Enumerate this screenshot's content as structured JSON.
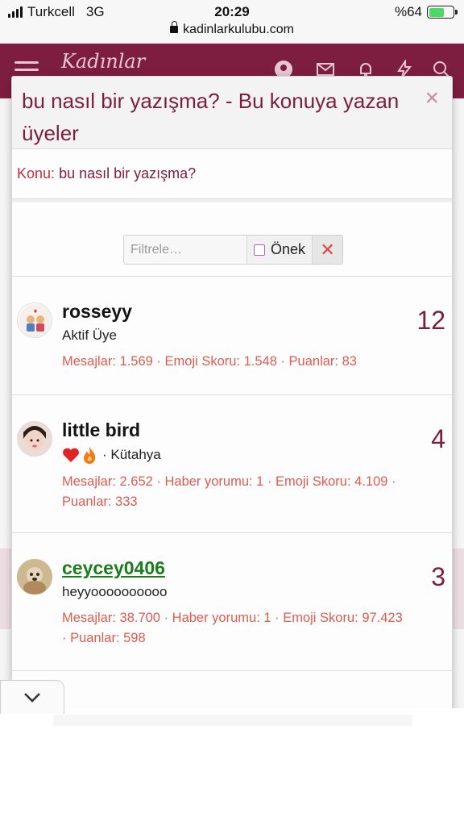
{
  "status_bar": {
    "carrier": "Turkcell",
    "network": "3G",
    "time": "20:29",
    "battery": "%64"
  },
  "browser": {
    "url": "kadinlarkulubu.com"
  },
  "site": {
    "logo": "Kadınlar"
  },
  "modal": {
    "title": "bu nasıl bir yazışma? - Bu konuya yazan üyeler",
    "close": "×",
    "topic_label": "Konu:",
    "topic_title": "bu nasıl bir yazışma?"
  },
  "filter": {
    "placeholder": "Filtrele…",
    "prefix_label": "Önek",
    "clear": "✕"
  },
  "members": [
    {
      "name": "rosseyy",
      "subtitle": "Aktif Üye",
      "stats": "Mesajlar: 1.569 · Emoji Skoru: 1.548 · Puanlar: 83",
      "count": "12"
    },
    {
      "name": "little bird",
      "subtitle": "· Kütahya",
      "stats": "Mesajlar: 2.652 · Haber yorumu: 1 · Emoji Skoru: 4.109 · Puanlar: 333",
      "count": "4"
    },
    {
      "name": "ceycey0406",
      "subtitle": "heyyoooooooooo",
      "stats": "Mesajlar: 38.700 · Haber yorumu: 1 · Emoji Skoru: 97.423 · Puanlar: 598",
      "count": "3"
    }
  ],
  "icons": {
    "collapse": "chevron-down-icon",
    "close": "close-icon"
  },
  "colors": {
    "brand": "#7d1d3f",
    "stats": "#e05b4f",
    "link_green": "#1b7d1b"
  }
}
